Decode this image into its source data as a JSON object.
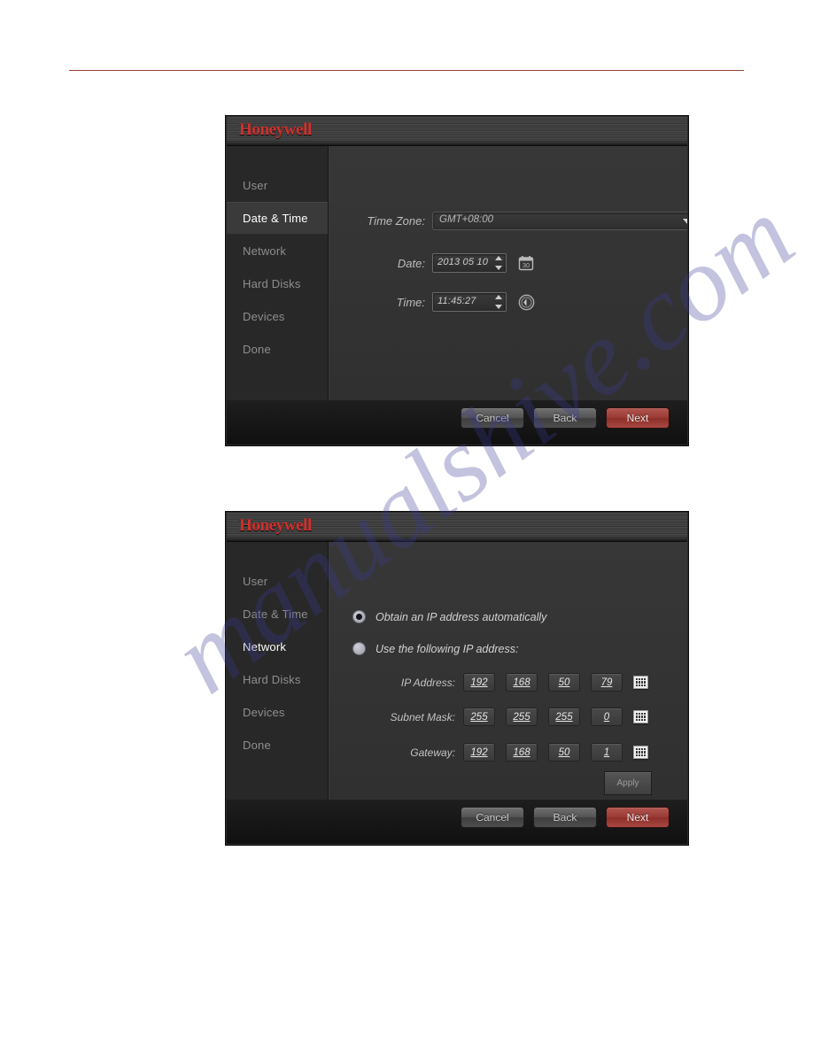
{
  "page": {
    "rule_color": "#9c4134",
    "background": "#ffffff"
  },
  "watermark": {
    "text": "manualshive.com",
    "color": "#3b3b96"
  },
  "dialogs": [
    {
      "id": "date-time",
      "brand": "Honeywell",
      "sidebar": {
        "items": [
          {
            "label": "User",
            "active": false
          },
          {
            "label": "Date & Time",
            "active": true
          },
          {
            "label": "Network",
            "active": false
          },
          {
            "label": "Hard Disks",
            "active": false
          },
          {
            "label": "Devices",
            "active": false
          },
          {
            "label": "Done",
            "active": false
          }
        ]
      },
      "fields": {
        "timezone_label": "Time Zone:",
        "timezone_value": "GMT+08:00",
        "date_label": "Date:",
        "date_value": "2013 05 10",
        "date_icon": "calendar-icon",
        "calendar_day": "30",
        "time_label": "Time:",
        "time_value": "11:45:27",
        "time_icon": "clock-icon"
      },
      "footer": {
        "cancel": "Cancel",
        "back": "Back",
        "next": "Next",
        "next_color": "#9c3a34"
      }
    },
    {
      "id": "network",
      "brand": "Honeywell",
      "sidebar": {
        "items": [
          {
            "label": "User",
            "active": false
          },
          {
            "label": "Date & Time",
            "active": false
          },
          {
            "label": "Network",
            "active": true
          },
          {
            "label": "Hard Disks",
            "active": false
          },
          {
            "label": "Devices",
            "active": false
          },
          {
            "label": "Done",
            "active": false
          }
        ]
      },
      "radios": [
        {
          "label": "Obtain an IP address automatically",
          "selected": true
        },
        {
          "label": "Use the following IP address:",
          "selected": false
        }
      ],
      "ip_rows": [
        {
          "label": "IP Address:",
          "octets": [
            "192",
            "168",
            "50",
            "79"
          ],
          "keypad": "keypad-icon"
        },
        {
          "label": "Subnet Mask:",
          "octets": [
            "255",
            "255",
            "255",
            "0"
          ],
          "keypad": "keypad-icon"
        },
        {
          "label": "Gateway:",
          "octets": [
            "192",
            "168",
            "50",
            "1"
          ],
          "keypad": "keypad-icon"
        }
      ],
      "apply_label": "Apply",
      "footer": {
        "cancel": "Cancel",
        "back": "Back",
        "next": "Next",
        "next_color": "#9c3a34"
      }
    }
  ]
}
